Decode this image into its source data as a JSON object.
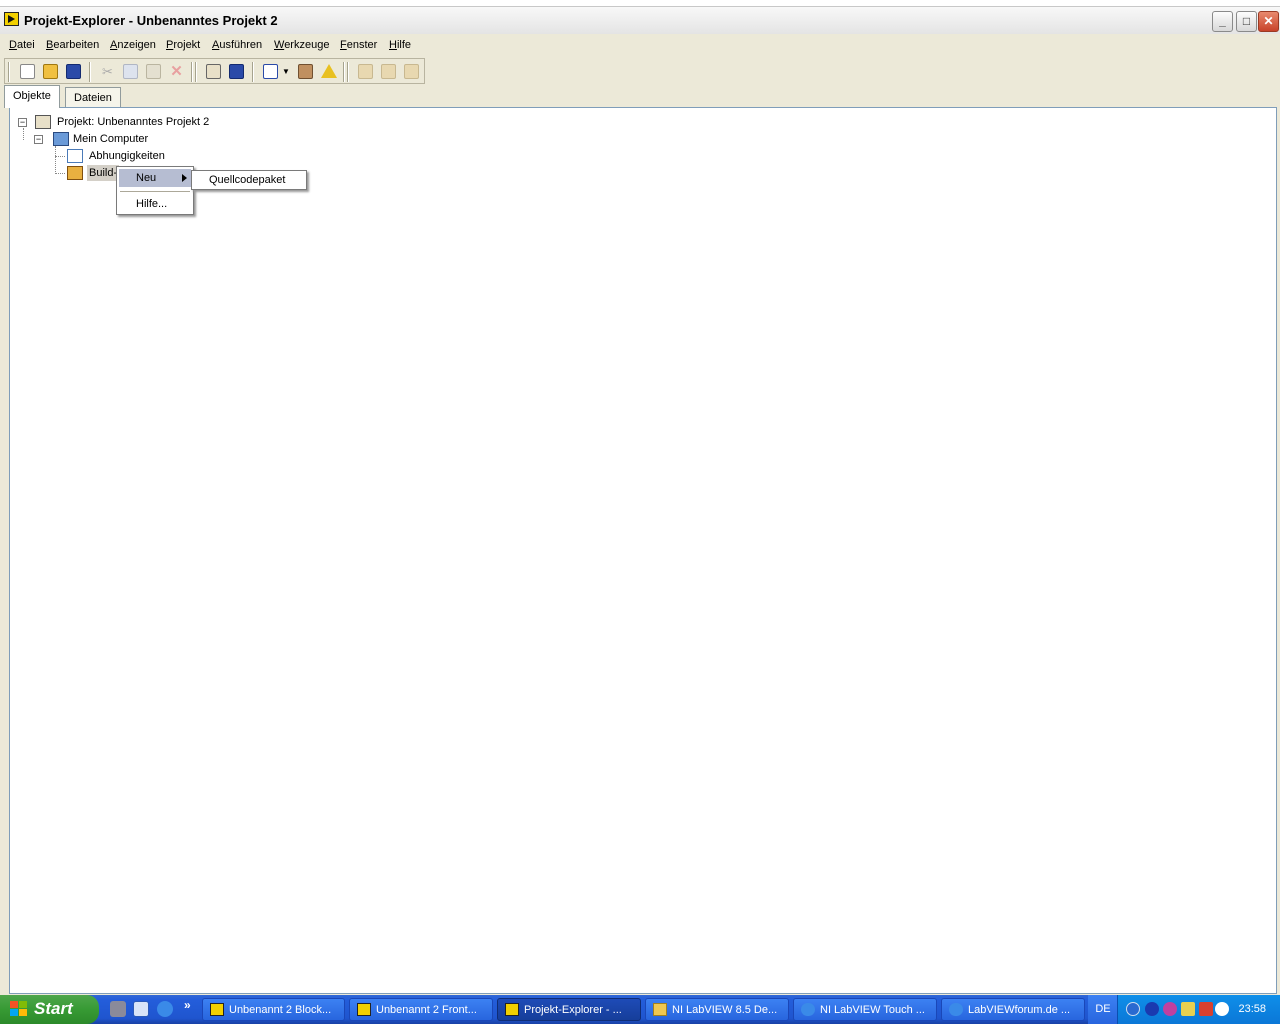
{
  "window": {
    "title": "Projekt-Explorer - Unbenanntes Projekt 2",
    "buttons": {
      "minimize": "_",
      "maximize": "□",
      "close": "✕"
    }
  },
  "menubar": [
    "Datei",
    "Bearbeiten",
    "Anzeigen",
    "Projekt",
    "Ausführen",
    "Werkzeuge",
    "Fenster",
    "Hilfe"
  ],
  "toolbar_icons": [
    "new-icon",
    "open-icon",
    "save-all-icon",
    "cut-icon",
    "copy-icon",
    "paste-icon",
    "delete-icon",
    "add-file-icon",
    "save-icon",
    "view-icon",
    "dropdown-arrow-icon",
    "build-icon",
    "warning-icon",
    "build-spec-icon",
    "package-icon",
    "deploy-icon"
  ],
  "tabs": {
    "objekte": "Objekte",
    "dateien": "Dateien"
  },
  "tree": {
    "project": "Projekt: Unbenanntes Projekt 2",
    "computer": "Mein Computer",
    "dependencies": "Abhungigkeiten",
    "build": "Build-"
  },
  "context_menu": {
    "neu": "Neu",
    "hilfe": "Hilfe...",
    "submenu_item": "Quellcodepaket"
  },
  "taskbar": {
    "start": "Start",
    "chevron": "»",
    "tasks": [
      "Unbenannt 2 Block...",
      "Unbenannt 2 Front...",
      "Projekt-Explorer - ...",
      "NI LabVIEW 8.5 De...",
      "NI LabVIEW Touch ...",
      "LabVIEWforum.de ..."
    ],
    "language": "DE",
    "clock": "23:58"
  },
  "colors": {
    "title_bg": "#ececec",
    "taskbar": "#245edb",
    "start": "#379a34",
    "menu_highlight": "#b6bdd2"
  }
}
